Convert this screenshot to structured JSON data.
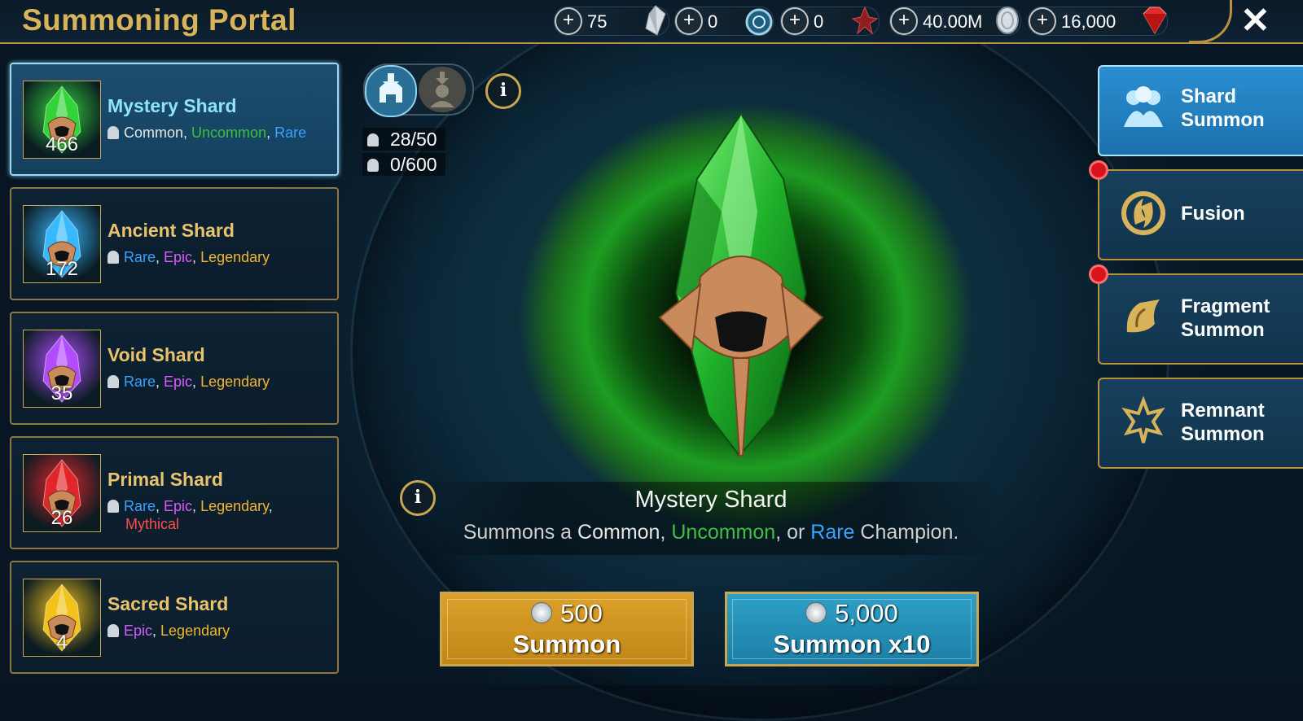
{
  "header": {
    "title": "Summoning Portal",
    "resources": [
      {
        "name": "energy",
        "value": "75",
        "icon": "crystal-icon"
      },
      {
        "name": "arena-tokens",
        "value": "0",
        "icon": "arena-token-icon"
      },
      {
        "name": "clan-boss-keys",
        "value": "0",
        "icon": "key-icon"
      },
      {
        "name": "silver",
        "value": "40.00M",
        "icon": "silver-coin-icon"
      },
      {
        "name": "gems",
        "value": "16,000",
        "icon": "gem-icon"
      }
    ]
  },
  "shards": [
    {
      "name": "Mystery Shard",
      "count": "466",
      "color": "#33d33a",
      "rarities": [
        {
          "t": "Common",
          "c": "c-common"
        },
        {
          "t": "Uncommon",
          "c": "c-unc"
        },
        {
          "t": "Rare",
          "c": "c-rare"
        }
      ]
    },
    {
      "name": "Ancient Shard",
      "count": "172",
      "color": "#37b8ff",
      "rarities": [
        {
          "t": "Rare",
          "c": "c-rare"
        },
        {
          "t": "Epic",
          "c": "c-epic"
        },
        {
          "t": "Legendary",
          "c": "c-leg"
        }
      ]
    },
    {
      "name": "Void Shard",
      "count": "35",
      "color": "#b14cff",
      "rarities": [
        {
          "t": "Rare",
          "c": "c-rare"
        },
        {
          "t": "Epic",
          "c": "c-epic"
        },
        {
          "t": "Legendary",
          "c": "c-leg"
        }
      ]
    },
    {
      "name": "Primal Shard",
      "count": "26",
      "color": "#e0262a",
      "rarities": [
        {
          "t": "Rare",
          "c": "c-rare"
        },
        {
          "t": "Epic",
          "c": "c-epic"
        },
        {
          "t": "Legendary",
          "c": "c-leg"
        },
        {
          "t": "Mythical",
          "c": "c-myth"
        }
      ]
    },
    {
      "name": "Sacred Shard",
      "count": "4",
      "color": "#f2c21a",
      "rarities": [
        {
          "t": "Epic",
          "c": "c-epic"
        },
        {
          "t": "Legendary",
          "c": "c-leg"
        }
      ]
    }
  ],
  "counters": {
    "champions": "28/50",
    "heroes": "0/600"
  },
  "detail": {
    "title": "Mystery Shard",
    "desc_prefix": "Summons a ",
    "desc_common": "Common",
    "desc_sep1": ", ",
    "desc_uncommon": "Uncommon",
    "desc_sep2": ", or ",
    "desc_rare": "Rare",
    "desc_suffix": " Champion."
  },
  "buttons": {
    "single_cost": "500",
    "single_label": "Summon",
    "multi_cost": "5,000",
    "multi_label": "Summon x10"
  },
  "tabs": [
    {
      "l1": "Shard",
      "l2": "Summon",
      "active": true
    },
    {
      "l1": "Fusion",
      "l2": "",
      "active": false
    },
    {
      "l1": "Fragment",
      "l2": "Summon",
      "active": false
    },
    {
      "l1": "Remnant",
      "l2": "Summon",
      "active": false
    }
  ],
  "colors": {
    "accent_gold": "#c9a64f",
    "title_gold": "#d9b35a",
    "uncommon": "#3ec03e",
    "rare": "#3aa2ff",
    "epic": "#d75bff",
    "legendary": "#f1b631",
    "mythical": "#ff4d4d"
  }
}
